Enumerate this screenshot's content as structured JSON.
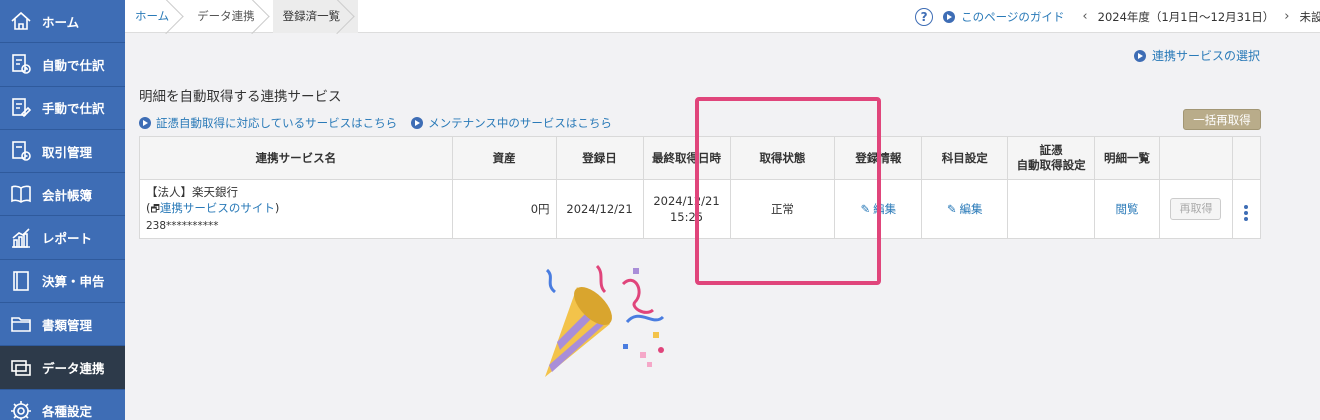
{
  "sidebar": {
    "items": [
      {
        "label": "ホーム",
        "icon": "home-icon"
      },
      {
        "label": "自動で仕訳",
        "icon": "auto-journal-icon"
      },
      {
        "label": "手動で仕訳",
        "icon": "manual-journal-icon"
      },
      {
        "label": "取引管理",
        "icon": "transaction-icon"
      },
      {
        "label": "会計帳簿",
        "icon": "ledger-book-icon"
      },
      {
        "label": "レポート",
        "icon": "report-chart-icon"
      },
      {
        "label": "決算・申告",
        "icon": "settlement-icon"
      },
      {
        "label": "書類管理",
        "icon": "folder-icon"
      },
      {
        "label": "データ連携",
        "icon": "data-link-icon"
      },
      {
        "label": "各種設定",
        "icon": "gear-icon"
      }
    ],
    "active_index": 8
  },
  "breadcrumb": {
    "items": [
      "ホーム",
      "データ連携",
      "登録済一覧"
    ]
  },
  "topbar": {
    "help": "?",
    "guide_label": "このページのガイド",
    "fiscal_year": "2024年度（1月1日〜12月31日）",
    "prev_arrow": "‹",
    "next_arrow": "›",
    "trailing_text": "未設定"
  },
  "main": {
    "select_service_link": "連携サービスの選択",
    "section_title": "明細を自動取得する連携サービス",
    "sub_links": [
      "証憑自動取得に対応しているサービスはこちら",
      "メンテナンス中のサービスはこちら"
    ],
    "bulk_refetch_button": "一括再取得",
    "table": {
      "headers": {
        "service_name": "連携サービス名",
        "assets": "資産",
        "registered_date": "登録日",
        "last_fetch": "最終取得日時",
        "status": "取得状態",
        "registration_info": "登録情報",
        "account_settings": "科目設定",
        "voucher_line1": "証憑",
        "voucher_line2": "自動取得設定",
        "statement_list": "明細一覧"
      },
      "rows": [
        {
          "name": "【法人】楽天銀行",
          "site_link": "連携サービスのサイト",
          "account": "238**********",
          "assets": "0円",
          "registered_date": "2024/12/21",
          "last_fetch_date": "2024/12/21",
          "last_fetch_time": "15:25",
          "status": "正常",
          "registration_edit": "編集",
          "account_edit": "編集",
          "statement_view": "閲覧",
          "refetch": "再取得"
        }
      ]
    }
  },
  "colors": {
    "sidebar_bg": "#3e6db5",
    "sidebar_active": "#2d3a4a",
    "link": "#2a7ab8",
    "highlight": "#e0457b",
    "bulk_button": "#b9ac8a"
  }
}
